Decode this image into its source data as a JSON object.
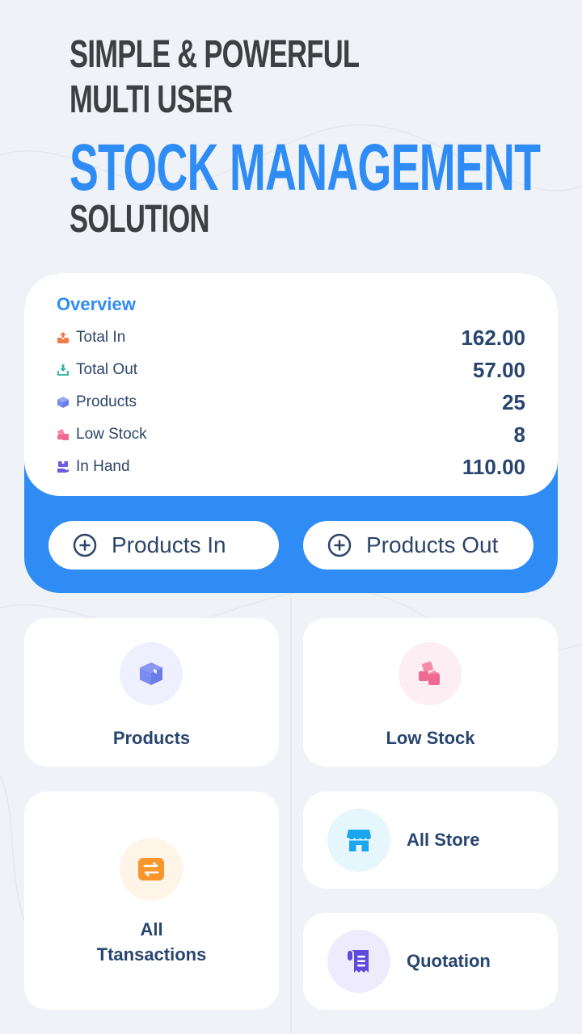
{
  "headline": {
    "line1": "Simple & Powerful",
    "line2": "Multi User",
    "line3": "Stock Management",
    "line4": "Solution"
  },
  "colors": {
    "accent": "#2f8cf5",
    "text_dark": "#284570",
    "headline_gray": "#3d3f42",
    "background": "#eff2f6"
  },
  "overview": {
    "title": "Overview",
    "rows": [
      {
        "icon": "upload-box-icon",
        "label": "Total In",
        "value": "162.00",
        "color": "#f07a4a"
      },
      {
        "icon": "download-box-icon",
        "label": "Total Out",
        "value": "57.00",
        "color": "#3bb3a6"
      },
      {
        "icon": "package-icon",
        "label": "Products",
        "value": "25",
        "color": "#7b8cf0"
      },
      {
        "icon": "boxes-icon",
        "label": "Low Stock",
        "value": "8",
        "color": "#ee6a92"
      },
      {
        "icon": "inventory-icon",
        "label": "In Hand",
        "value": "110.00",
        "color": "#6b5ce0"
      }
    ]
  },
  "actions": {
    "products_in": "Products In",
    "products_out": "Products Out"
  },
  "tiles": {
    "products": {
      "label": "Products",
      "icon": "package-icon"
    },
    "low_stock": {
      "label": "Low Stock",
      "icon": "boxes-icon"
    },
    "transactions": {
      "label_line1": "All",
      "label_line2": "Ttansactions",
      "icon": "exchange-icon"
    },
    "all_store": {
      "label": "All Store",
      "icon": "store-icon"
    },
    "quotation": {
      "label": "Quotation",
      "icon": "receipt-icon"
    }
  }
}
